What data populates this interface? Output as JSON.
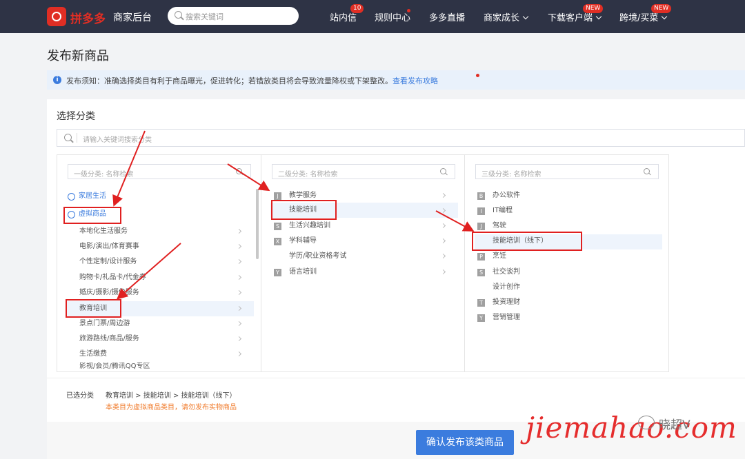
{
  "topbar": {
    "logo_text": "拼多多",
    "logo_sub": "商家后台",
    "search_placeholder": "搜索关键词",
    "nav": [
      {
        "label": "站内信",
        "badge": "10"
      },
      {
        "label": "规则中心"
      },
      {
        "label": "多多直播"
      },
      {
        "label": "商家成长"
      },
      {
        "label": "下载客户端",
        "badge": "NEW"
      },
      {
        "label": "跨境/买菜",
        "badge": "NEW"
      }
    ]
  },
  "page": {
    "title": "发布新商品",
    "notice_text": "发布须知：准确选择类目有利于商品曝光，促进转化；若错放类目将会导致流量降权或下架整改。",
    "notice_link": "查看发布攻略",
    "section_title": "选择分类",
    "keyword_placeholder": "请输入关键词搜索分类"
  },
  "columns": {
    "level1": {
      "placeholder": "一级分类: 名称检索",
      "groups": [
        {
          "label": "家居生活",
          "expanded": false
        },
        {
          "label": "虚拟商品",
          "expanded": true
        }
      ],
      "items": [
        "本地化生活服务",
        "电影/演出/体育赛事",
        "个性定制/设计服务",
        "购物卡/礼品卡/代金券",
        "婚庆/摄影/摄像服务",
        "教育培训",
        "景点门票/周边游",
        "旅游路线/商品/服务",
        "生活缴费",
        "影视/会员/腾讯QQ专区"
      ],
      "selected": "教育培训"
    },
    "level2": {
      "placeholder": "二级分类: 名称检索",
      "items": [
        {
          "letter": "J",
          "label": "教学服务"
        },
        {
          "letter": "",
          "label": "技能培训"
        },
        {
          "letter": "S",
          "label": "生活兴趣培训"
        },
        {
          "letter": "X",
          "label": "学科辅导"
        },
        {
          "letter": "",
          "label": "学历/职业资格考试"
        },
        {
          "letter": "Y",
          "label": "语言培训"
        }
      ],
      "selected": "技能培训"
    },
    "level3": {
      "placeholder": "三级分类: 名称检索",
      "items": [
        {
          "letter": "B",
          "label": "办公软件"
        },
        {
          "letter": "I",
          "label": "IT编程"
        },
        {
          "letter": "J",
          "label": "驾驶"
        },
        {
          "letter": "",
          "label": "技能培训（线下）"
        },
        {
          "letter": "P",
          "label": "烹饪"
        },
        {
          "letter": "S",
          "label": "社交谈判"
        },
        {
          "letter": "",
          "label": "设计创作"
        },
        {
          "letter": "T",
          "label": "投资理财"
        },
        {
          "letter": "Y",
          "label": "营销管理"
        }
      ],
      "selected": "技能培训（线下）"
    }
  },
  "footer": {
    "chosen_label": "已选分类",
    "chosen_path": "教育培训 > 技能培训 > 技能培训（线下）",
    "warning": "本类目为虚拟商品类目，请勿发布实物商品",
    "confirm_button": "确认发布该类商品"
  },
  "watermark": {
    "site": "jiemahao.com",
    "account": "晓超V"
  },
  "colors": {
    "topbar": "#2e3345",
    "brand": "#e02e24",
    "primary": "#3b7cde",
    "warning": "#f07a2a",
    "annotation": "#e02020"
  }
}
